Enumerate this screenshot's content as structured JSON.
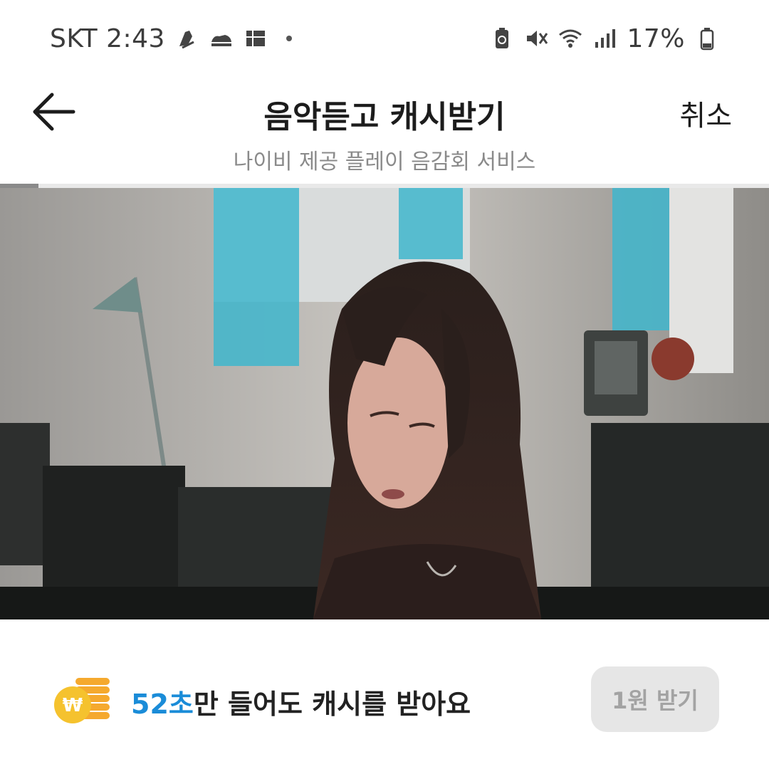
{
  "status_bar": {
    "carrier_time": "SKT 2:43",
    "battery": "17%",
    "left_icons": [
      "shoe-icon",
      "sneaker-icon",
      "grid-icon"
    ],
    "right_icons": [
      "battery-saver-icon",
      "mute-icon",
      "wifi-icon",
      "signal-icon",
      "battery-icon"
    ]
  },
  "header": {
    "title": "음악듣고 캐시받기",
    "cancel_label": "취소",
    "subtitle": "나이비 제공 플레이 음감회 서비스",
    "back_icon": "arrow-left-icon"
  },
  "progress": {
    "percent": 5
  },
  "footer": {
    "seconds": "52초",
    "message": "만 들어도 캐시를 받아요",
    "claim_label": "1원 받기",
    "coin_icon": "won-coin-icon"
  },
  "colors": {
    "accent": "#1a8cd8",
    "coin": "#f5c22e",
    "button_bg": "#e6e6e6",
    "button_text": "#a3a3a3"
  }
}
